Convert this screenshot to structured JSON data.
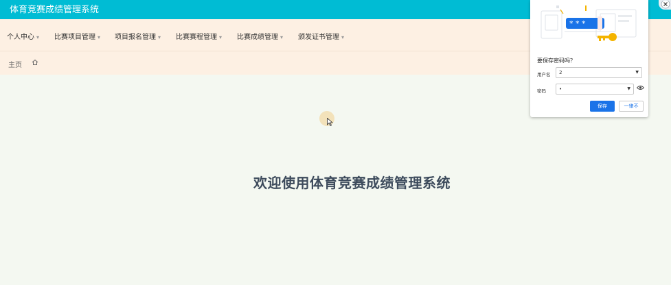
{
  "app": {
    "title": "体育竞赛成绩管理系统"
  },
  "nav": {
    "items": [
      {
        "label": "个人中心"
      },
      {
        "label": "比赛项目管理"
      },
      {
        "label": "项目报名管理"
      },
      {
        "label": "比赛赛程管理"
      },
      {
        "label": "比赛成绩管理"
      },
      {
        "label": "颁发证书管理"
      }
    ],
    "caret": "▾"
  },
  "breadcrumb": {
    "home_label": "主页"
  },
  "main": {
    "welcome": "欢迎使用体育竞赛成绩管理系统"
  },
  "password_popup": {
    "question": "要保存密码吗？",
    "username_label": "用户名",
    "username_value": "2",
    "password_label": "密码",
    "password_value": "•",
    "save_label": "保存",
    "never_label": "一律不",
    "mask_glyphs": "* * *",
    "accent": "#1a73e8"
  },
  "colors": {
    "header": "#00bcd4",
    "nav_bg": "#fdf0e3",
    "page_bg": "#f4f8f1"
  }
}
